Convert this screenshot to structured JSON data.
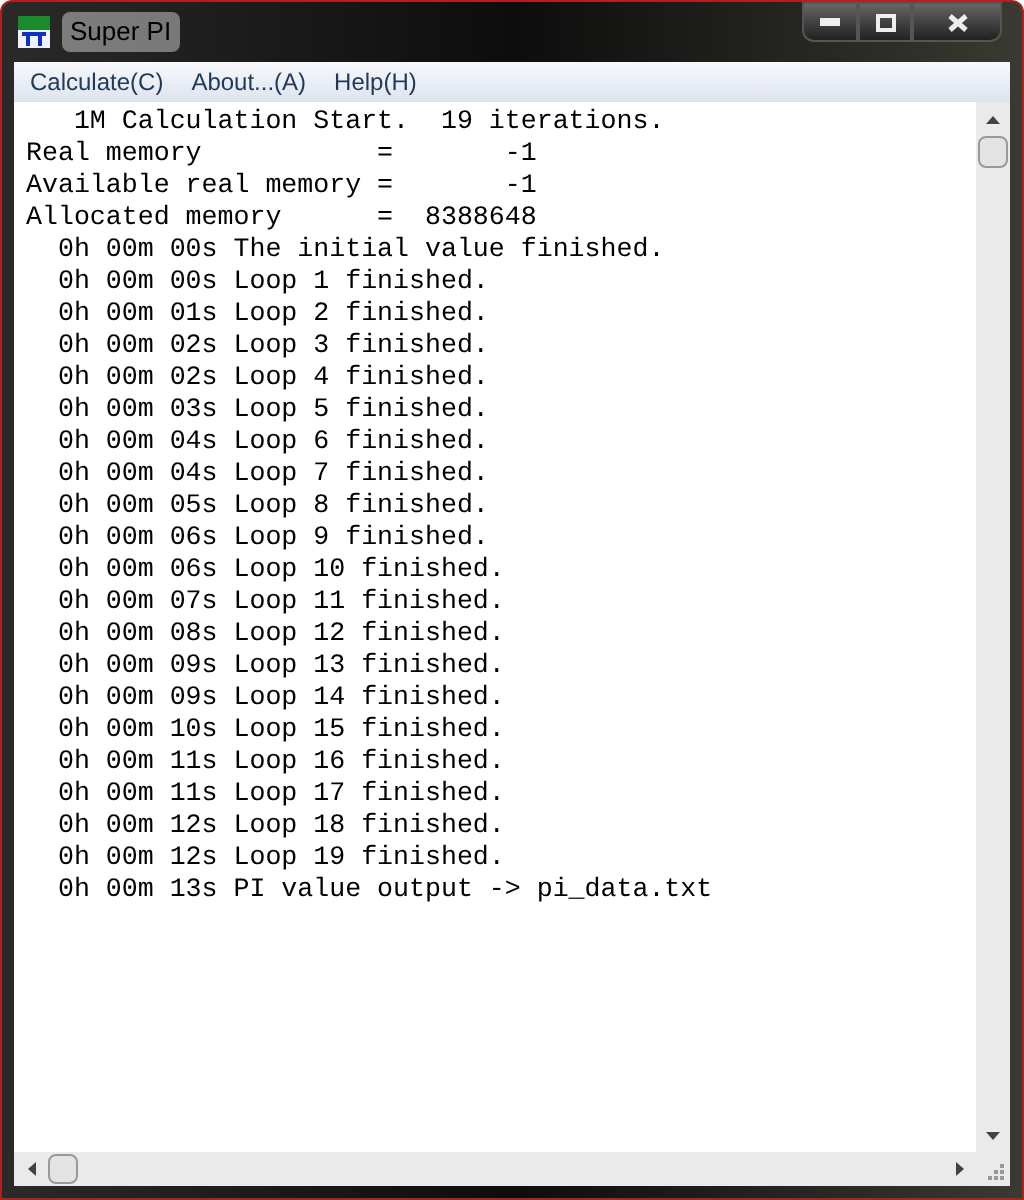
{
  "window": {
    "title": "Super PI"
  },
  "menu": [
    {
      "label": "Calculate(C)"
    },
    {
      "label": "About...(A)"
    },
    {
      "label": "Help(H)"
    }
  ],
  "output_lines": [
    "   1M Calculation Start.  19 iterations.",
    "Real memory           =       -1",
    "Available real memory =       -1",
    "Allocated memory      =  8388648",
    "  0h 00m 00s The initial value finished.",
    "  0h 00m 00s Loop 1 finished.",
    "  0h 00m 01s Loop 2 finished.",
    "  0h 00m 02s Loop 3 finished.",
    "  0h 00m 02s Loop 4 finished.",
    "  0h 00m 03s Loop 5 finished.",
    "  0h 00m 04s Loop 6 finished.",
    "  0h 00m 04s Loop 7 finished.",
    "  0h 00m 05s Loop 8 finished.",
    "  0h 00m 06s Loop 9 finished.",
    "  0h 00m 06s Loop 10 finished.",
    "  0h 00m 07s Loop 11 finished.",
    "  0h 00m 08s Loop 12 finished.",
    "  0h 00m 09s Loop 13 finished.",
    "  0h 00m 09s Loop 14 finished.",
    "  0h 00m 10s Loop 15 finished.",
    "  0h 00m 11s Loop 16 finished.",
    "  0h 00m 11s Loop 17 finished.",
    "  0h 00m 12s Loop 18 finished.",
    "  0h 00m 12s Loop 19 finished.",
    "  0h 00m 13s PI value output -> pi_data.txt"
  ]
}
